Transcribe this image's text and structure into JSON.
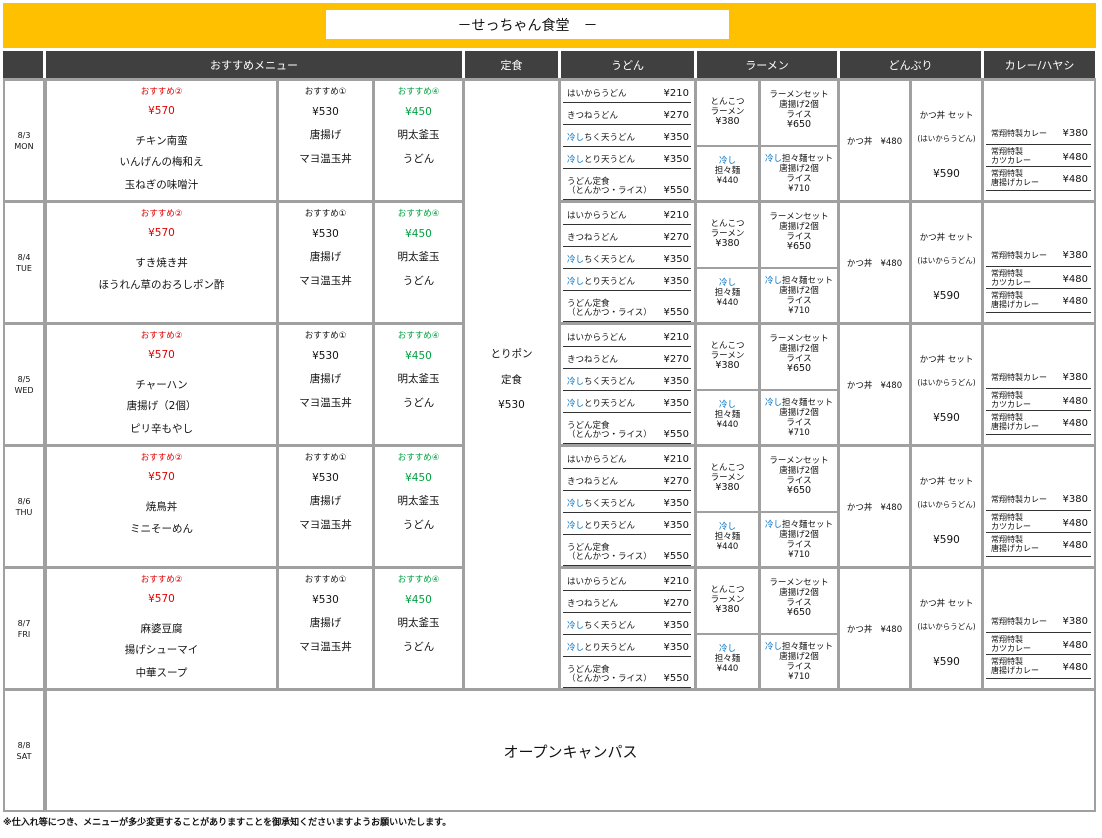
{
  "title": "－せっちゃん食堂　－",
  "headers": {
    "recommend": "おすすめメニュー",
    "teishoku": "定食",
    "udon": "うどん",
    "ramen": "ラーメン",
    "donburi": "どんぶり",
    "curry": "カレー/ハヤシ"
  },
  "days": [
    {
      "date": "8/3",
      "dow": "MON",
      "rec2": {
        "label": "おすすめ②",
        "price": "¥570",
        "items": [
          "チキン南蛮",
          "いんげんの梅和え",
          "玉ねぎの味噌汁"
        ]
      },
      "rec1": {
        "label": "おすすめ①",
        "price": "¥530",
        "items": [
          "唐揚げ",
          "マヨ温玉丼"
        ]
      },
      "rec4": {
        "label": "おすすめ④",
        "price": "¥450",
        "items": [
          "明太釜玉",
          "うどん"
        ]
      }
    },
    {
      "date": "8/4",
      "dow": "TUE",
      "rec2": {
        "label": "おすすめ②",
        "price": "¥570",
        "items": [
          "すき焼き丼",
          "ほうれん草のおろしポン酢"
        ]
      },
      "rec1": {
        "label": "おすすめ①",
        "price": "¥530",
        "items": [
          "唐揚げ",
          "マヨ温玉丼"
        ]
      },
      "rec4": {
        "label": "おすすめ④",
        "price": "¥450",
        "items": [
          "明太釜玉",
          "うどん"
        ]
      }
    },
    {
      "date": "8/5",
      "dow": "WED",
      "rec2": {
        "label": "おすすめ②",
        "price": "¥570",
        "items": [
          "チャーハン",
          "唐揚げ（2個）",
          "ピリ辛もやし"
        ]
      },
      "rec1": {
        "label": "おすすめ①",
        "price": "¥530",
        "items": [
          "唐揚げ",
          "マヨ温玉丼"
        ]
      },
      "rec4": {
        "label": "おすすめ④",
        "price": "¥450",
        "items": [
          "明太釜玉",
          "うどん"
        ]
      }
    },
    {
      "date": "8/6",
      "dow": "THU",
      "rec2": {
        "label": "おすすめ②",
        "price": "¥570",
        "items": [
          "焼鳥丼",
          "ミニそーめん"
        ]
      },
      "rec1": {
        "label": "おすすめ①",
        "price": "¥530",
        "items": [
          "唐揚げ",
          "マヨ温玉丼"
        ]
      },
      "rec4": {
        "label": "おすすめ④",
        "price": "¥450",
        "items": [
          "明太釜玉",
          "うどん"
        ]
      }
    },
    {
      "date": "8/7",
      "dow": "FRI",
      "rec2": {
        "label": "おすすめ②",
        "price": "¥570",
        "items": [
          "麻婆豆腐",
          "揚げシューマイ",
          "中華スープ"
        ]
      },
      "rec1": {
        "label": "おすすめ①",
        "price": "¥530",
        "items": [
          "唐揚げ",
          "マヨ温玉丼"
        ]
      },
      "rec4": {
        "label": "おすすめ④",
        "price": "¥450",
        "items": [
          "明太釜玉",
          "うどん"
        ]
      }
    }
  ],
  "teishoku": {
    "lines": [
      "とりポン",
      "定食",
      "¥530"
    ]
  },
  "udon": [
    {
      "prefix": "",
      "name": "はいからうどん",
      "price": "¥210"
    },
    {
      "prefix": "",
      "name": "きつねうどん",
      "price": "¥270"
    },
    {
      "prefix": "冷し",
      "name": "ちく天うどん",
      "price": "¥350"
    },
    {
      "prefix": "冷し",
      "name": "とり天うどん",
      "price": "¥350"
    },
    {
      "prefix": "",
      "name": "うどん定食",
      "name2": "（とんかつ・ライス）",
      "price": "¥550"
    }
  ],
  "ramen": {
    "tonkotsu": [
      "とんこつ",
      "ラーメン",
      "¥380"
    ],
    "set": [
      "ラーメンセット",
      "唐揚げ2個",
      "ライス",
      "¥650"
    ],
    "hiyashi_prefix": "冷し",
    "hiyashi": [
      "担々麺",
      "¥440"
    ],
    "tantan_prefix": "冷し",
    "tantan_set": [
      "担々麺セット",
      "唐揚げ2個",
      "ライス",
      "¥710"
    ]
  },
  "donburi": {
    "katsudon": "かつ丼",
    "katsudon_price": "¥480",
    "set_name": "かつ丼 セット",
    "set_desc": "(はいからうどん)",
    "set_price": "¥590"
  },
  "curry": [
    {
      "name": "常翔特製カレー",
      "price": "¥380"
    },
    {
      "name": "常翔特製",
      "name2": "カツカレー",
      "price": "¥480"
    },
    {
      "name": "常翔特製",
      "name2": "唐揚げカレー",
      "price": "¥480"
    }
  ],
  "saturday": {
    "date": "8/8",
    "dow": "SAT",
    "event": "オープンキャンパス"
  },
  "note": "※仕入れ等につき、メニューが多少変更することがありますことを御承知くださいますようお願いいたします。"
}
